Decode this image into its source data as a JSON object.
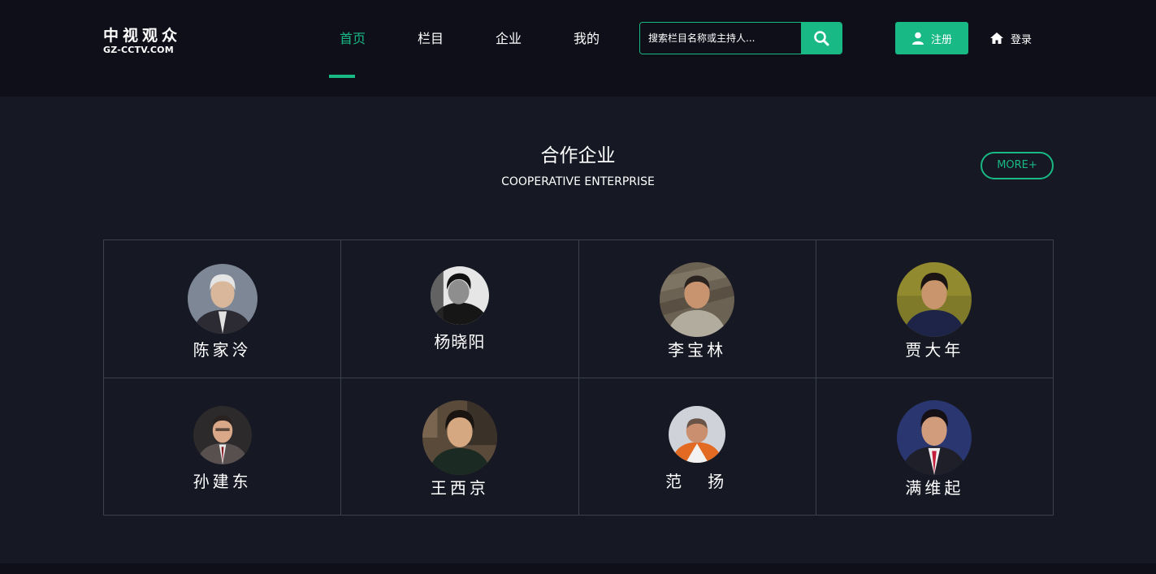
{
  "header": {
    "logo_cn": "中视观众",
    "logo_en": "GZ-CCTV.COM",
    "nav": [
      {
        "label": "首页",
        "active": true
      },
      {
        "label": "栏目",
        "active": false
      },
      {
        "label": "企业",
        "active": false
      },
      {
        "label": "我的",
        "active": false
      }
    ],
    "search_placeholder": "搜索栏目名称或主持人...",
    "search_icon": "search-icon",
    "register_label": "注册",
    "register_icon": "user-icon",
    "login_label": "登录",
    "login_icon": "home-icon"
  },
  "section": {
    "title": "合作企业",
    "subtitle": "COOPERATIVE ENTERPRISE",
    "more_label": "MORE+"
  },
  "people": [
    {
      "name": "陈家泠"
    },
    {
      "name": "杨晓阳"
    },
    {
      "name": "李宝林"
    },
    {
      "name": "贾大年"
    },
    {
      "name": "孙建东"
    },
    {
      "name": "王西京"
    },
    {
      "name": "范　扬"
    },
    {
      "name": "满维起"
    }
  ],
  "colors": {
    "accent": "#19b986",
    "header_bg": "#0f0f1a",
    "page_bg": "#161823",
    "grid_line": "#3c3f4c"
  }
}
